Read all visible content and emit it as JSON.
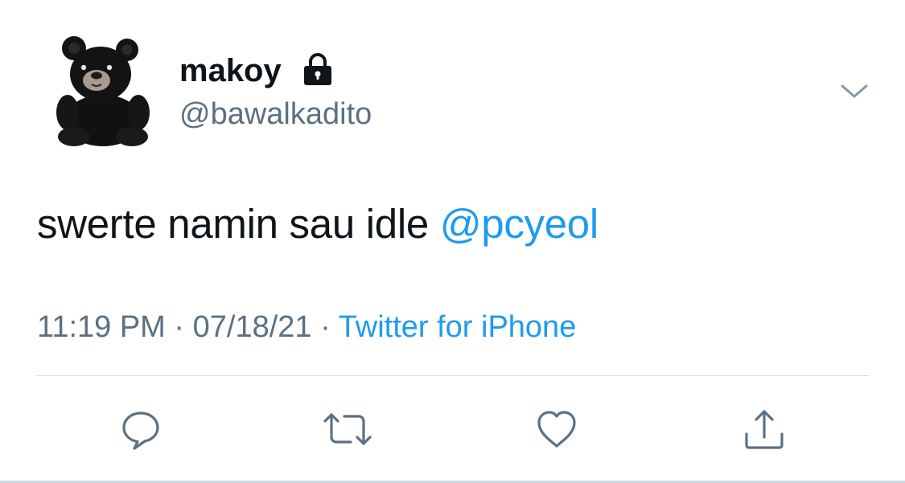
{
  "user": {
    "display_name": "makoy",
    "username": "@bawalkadito",
    "avatar_icon": "teddy-bear-avatar",
    "protected_icon": "lock-icon"
  },
  "tweet": {
    "text": "swerte namin sau idle ",
    "mention": "@pcyeol",
    "time": "11:19 PM",
    "separator": " · ",
    "date": "07/18/21",
    "source": "Twitter for iPhone"
  },
  "actions": [
    {
      "name": "reply",
      "icon": "comment-icon"
    },
    {
      "name": "retweet",
      "icon": "retweet-icon"
    },
    {
      "name": "like",
      "icon": "heart-icon"
    },
    {
      "name": "share",
      "icon": "share-icon"
    }
  ],
  "colors": {
    "text": "#0f1419",
    "secondary": "#5b7083",
    "link": "#1d9bf0",
    "divider": "#cfd9de"
  }
}
